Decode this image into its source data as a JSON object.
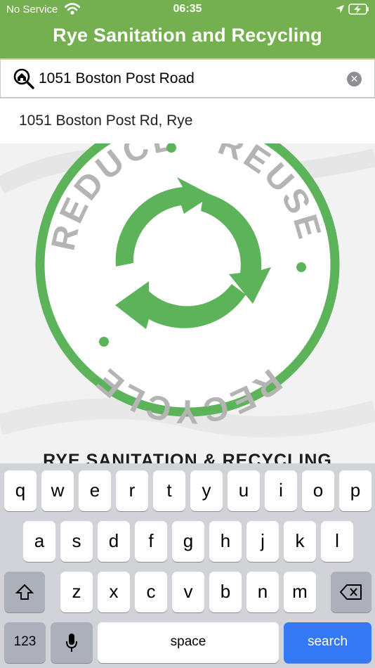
{
  "status_bar": {
    "carrier": "No Service",
    "time": "06:35"
  },
  "header": {
    "title": "Rye Sanitation and Recycling"
  },
  "search": {
    "value": "1051 Boston Post Road",
    "clear_symbol": "✕"
  },
  "suggestion": {
    "text": "1051 Boston Post Rd, Rye"
  },
  "logo": {
    "ring_words": [
      "REDUCE",
      "REUSE",
      "RECYCLE"
    ],
    "brand_text": "RYE SANITATION & RECYCLING",
    "colors": {
      "green": "#5cb35a",
      "grey": "#b4b4b4"
    }
  },
  "keyboard": {
    "row1": [
      "q",
      "w",
      "e",
      "r",
      "t",
      "y",
      "u",
      "i",
      "o",
      "p"
    ],
    "row2": [
      "a",
      "s",
      "d",
      "f",
      "g",
      "h",
      "j",
      "k",
      "l"
    ],
    "row3": [
      "z",
      "x",
      "c",
      "v",
      "b",
      "n",
      "m"
    ],
    "numbers_label": "123",
    "space_label": "space",
    "search_label": "search"
  }
}
